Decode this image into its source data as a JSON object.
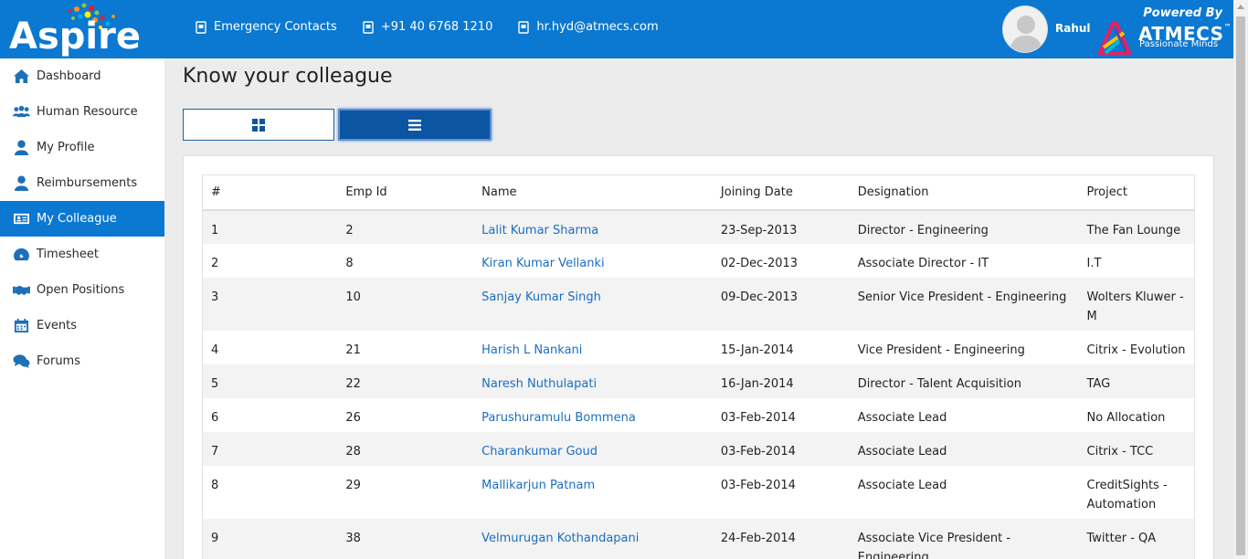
{
  "header": {
    "logo_text": "Aspire",
    "contacts": [
      {
        "icon": "phone-icon",
        "label": "Emergency Contacts"
      },
      {
        "icon": "phone-icon",
        "label": "+91 40 6768 1210"
      },
      {
        "icon": "phone-icon",
        "label": "hr.hyd@atmecs.com"
      }
    ],
    "user_name": "Rahul",
    "powered_by": "Powered By",
    "company_name": "ATMECS",
    "company_tm": "™",
    "company_tagline": "Passionate Minds"
  },
  "sidebar": {
    "items": [
      {
        "label": "Dashboard",
        "icon": "home-icon"
      },
      {
        "label": "Human Resource",
        "icon": "users-icon"
      },
      {
        "label": "My Profile",
        "icon": "user-icon"
      },
      {
        "label": "Reimbursements",
        "icon": "user-icon"
      },
      {
        "label": "My Colleague",
        "icon": "id-card-icon",
        "active": true
      },
      {
        "label": "Timesheet",
        "icon": "dashboard-icon"
      },
      {
        "label": "Open Positions",
        "icon": "handshake-icon"
      },
      {
        "label": "Events",
        "icon": "calendar-icon"
      },
      {
        "label": "Forums",
        "icon": "comments-icon"
      }
    ]
  },
  "main": {
    "title": "Know your colleague",
    "view_toggle": {
      "grid_icon": "grid-icon",
      "list_icon": "list-icon",
      "selected": "list"
    },
    "table": {
      "headers": [
        "#",
        "Emp Id",
        "Name",
        "Joining Date",
        "Designation",
        "Project"
      ],
      "rows": [
        {
          "num": "1",
          "emp_id": "2",
          "name": "Lalit Kumar Sharma",
          "joining_date": "23-Sep-2013",
          "designation": "Director - Engineering",
          "project": "The Fan Lounge"
        },
        {
          "num": "2",
          "emp_id": "8",
          "name": "Kiran Kumar Vellanki",
          "joining_date": "02-Dec-2013",
          "designation": "Associate Director - IT",
          "project": "I.T"
        },
        {
          "num": "3",
          "emp_id": "10",
          "name": "Sanjay Kumar Singh",
          "joining_date": "09-Dec-2013",
          "designation": "Senior Vice President - Engineering",
          "project": "Wolters Kluwer - M"
        },
        {
          "num": "4",
          "emp_id": "21",
          "name": "Harish L Nankani",
          "joining_date": "15-Jan-2014",
          "designation": "Vice President - Engineering",
          "project": "Citrix - Evolution"
        },
        {
          "num": "5",
          "emp_id": "22",
          "name": "Naresh Nuthulapati",
          "joining_date": "16-Jan-2014",
          "designation": "Director - Talent Acquisition",
          "project": "TAG"
        },
        {
          "num": "6",
          "emp_id": "26",
          "name": "Parushuramulu Bommena",
          "joining_date": "03-Feb-2014",
          "designation": "Associate Lead",
          "project": "No Allocation"
        },
        {
          "num": "7",
          "emp_id": "28",
          "name": "Charankumar Goud",
          "joining_date": "03-Feb-2014",
          "designation": "Associate Lead",
          "project": "Citrix - TCC"
        },
        {
          "num": "8",
          "emp_id": "29",
          "name": "Mallikarjun Patnam",
          "joining_date": "03-Feb-2014",
          "designation": "Associate Lead",
          "project": "CreditSights - Automation"
        },
        {
          "num": "9",
          "emp_id": "38",
          "name": "Velmurugan Kothandapani",
          "joining_date": "24-Feb-2014",
          "designation": "Associate Vice President - Engineering",
          "project": "Twitter - QA"
        }
      ]
    }
  },
  "colors": {
    "primary": "#0b78d1",
    "link": "#1b6ec2",
    "active_toggle": "#0b55a3"
  }
}
